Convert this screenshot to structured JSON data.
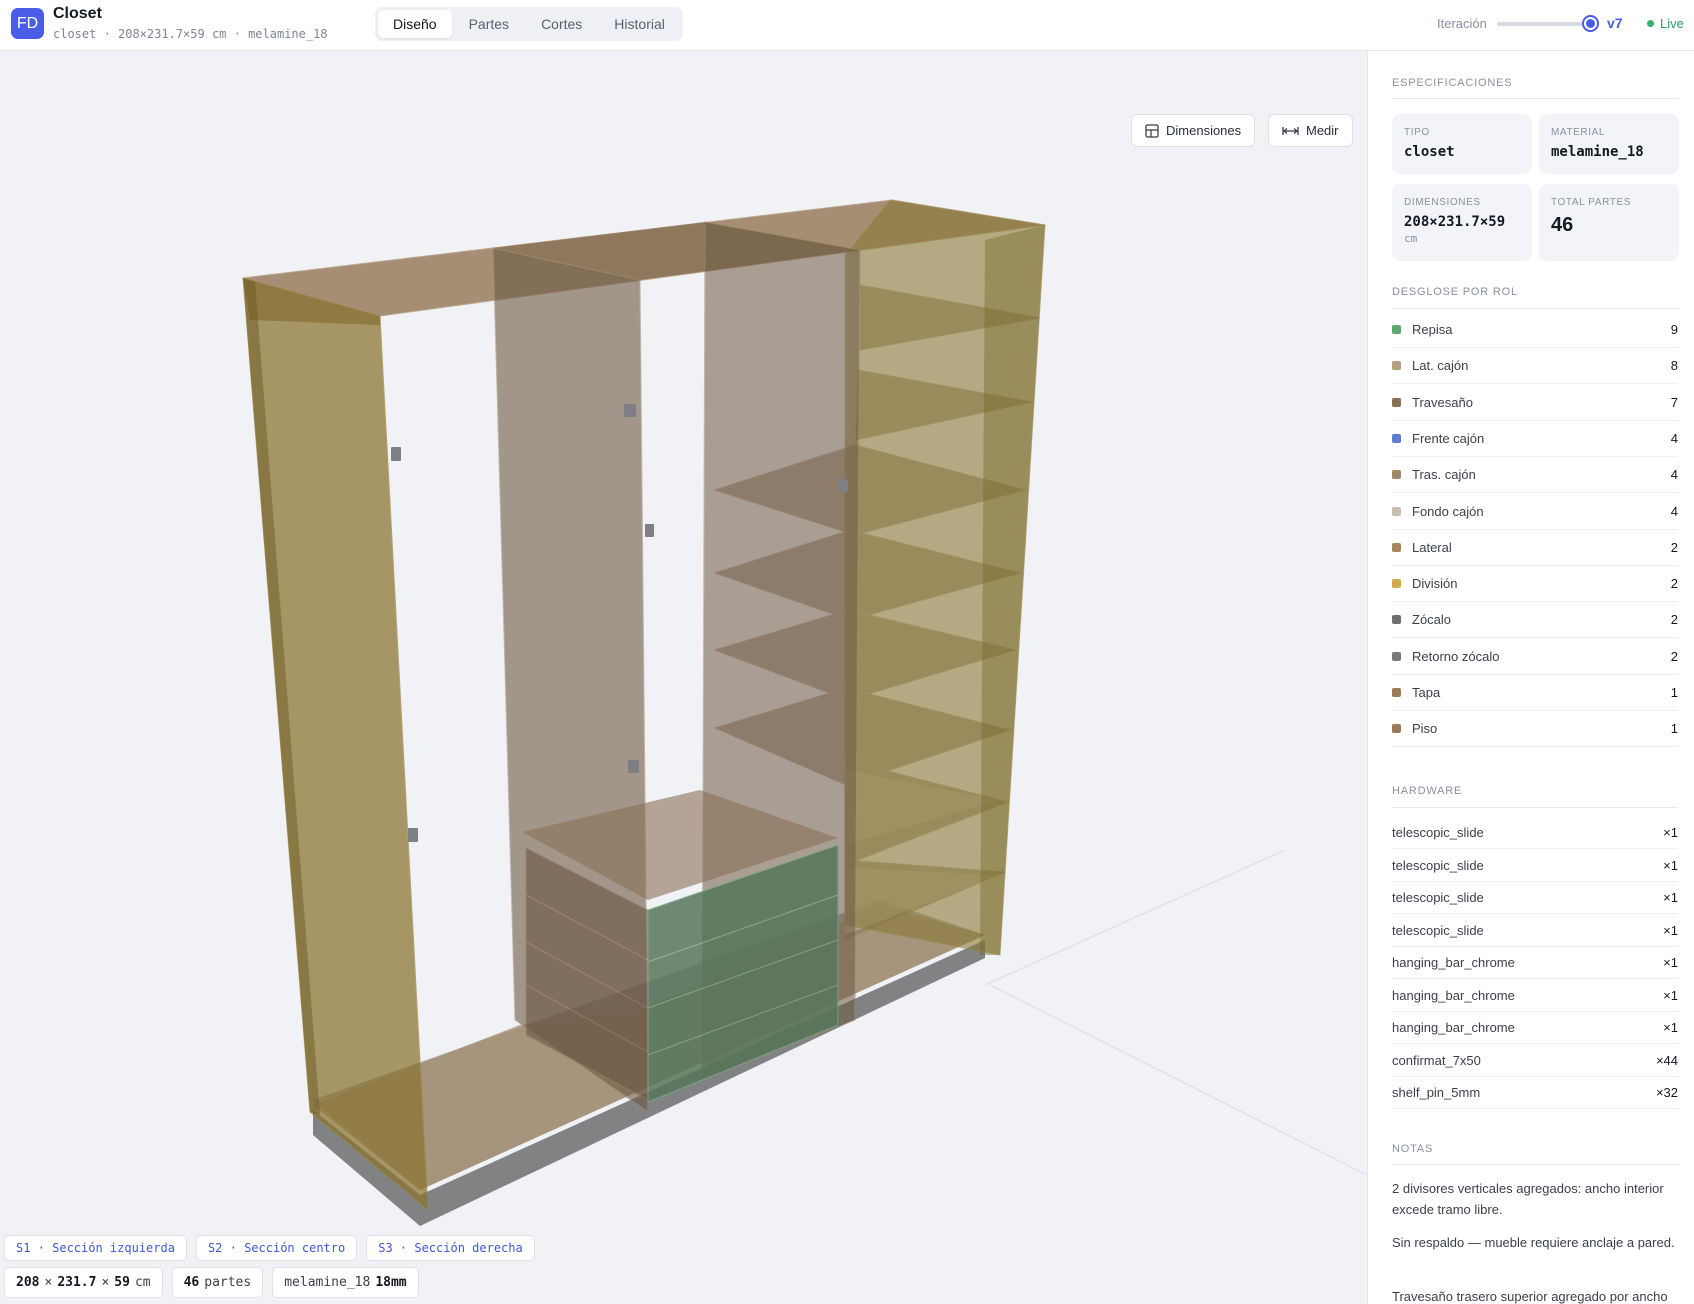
{
  "header": {
    "logo": "FD",
    "title": "Closet",
    "subtitle": "closet · 208×231.7×59 cm · melamine_18",
    "tabs": [
      "Diseño",
      "Partes",
      "Cortes",
      "Historial"
    ],
    "active_tab": "Diseño",
    "iteration_label": "Iteración",
    "iteration_version": "v7",
    "iteration_level": 1.0,
    "live_label": "Live"
  },
  "viewport": {
    "dimensions_button": "Dimensiones",
    "measure_button": "Medir",
    "sections": [
      "S1 · Sección izquierda",
      "S2 · Sección centro",
      "S3 · Sección derecha"
    ],
    "dims": {
      "w": "208",
      "h": "231.7",
      "d": "59",
      "sep": "×",
      "unit": "cm"
    },
    "parts": {
      "count": "46",
      "label": "partes"
    },
    "material": {
      "name": "melamine_18",
      "thickness": "18mm"
    }
  },
  "sidebar": {
    "specs_title": "Especificaciones",
    "specs": {
      "tipo_label": "Tipo",
      "tipo": "closet",
      "material_label": "Material",
      "material": "melamine_18",
      "dims_label": "Dimensiones",
      "dims": "208×231.7×59",
      "dims_unit": "cm",
      "total_label": "Total partes",
      "total": "46"
    },
    "roles_title": "Desglose por rol",
    "roles": [
      {
        "name": "Repisa",
        "count": "9",
        "color": "#5fa86b"
      },
      {
        "name": "Lat. cajón",
        "count": "8",
        "color": "#b3a07d"
      },
      {
        "name": "Travesaño",
        "count": "7",
        "color": "#8a6f53"
      },
      {
        "name": "Frente cajón",
        "count": "4",
        "color": "#5a7fd0"
      },
      {
        "name": "Tras. cajón",
        "count": "4",
        "color": "#a08866"
      },
      {
        "name": "Fondo cajón",
        "count": "4",
        "color": "#c9bfae"
      },
      {
        "name": "Lateral",
        "count": "2",
        "color": "#a6865a"
      },
      {
        "name": "División",
        "count": "2",
        "color": "#d4aa48"
      },
      {
        "name": "Zócalo",
        "count": "2",
        "color": "#6f6f6f"
      },
      {
        "name": "Retorno zócalo",
        "count": "2",
        "color": "#7a7a7a"
      },
      {
        "name": "Tapa",
        "count": "1",
        "color": "#9a7c56"
      },
      {
        "name": "Piso",
        "count": "1",
        "color": "#9a7c56"
      }
    ],
    "hardware_title": "Hardware",
    "hardware": [
      {
        "name": "telescopic_slide",
        "qty": "×1"
      },
      {
        "name": "telescopic_slide",
        "qty": "×1"
      },
      {
        "name": "telescopic_slide",
        "qty": "×1"
      },
      {
        "name": "telescopic_slide",
        "qty": "×1"
      },
      {
        "name": "hanging_bar_chrome",
        "qty": "×1"
      },
      {
        "name": "hanging_bar_chrome",
        "qty": "×1"
      },
      {
        "name": "hanging_bar_chrome",
        "qty": "×1"
      },
      {
        "name": "confirmat_7x50",
        "qty": "×44"
      },
      {
        "name": "shelf_pin_5mm",
        "qty": "×32"
      }
    ],
    "notes_title": "Notas",
    "notes": [
      "2 divisores verticales agregados: ancho interior excede tramo libre.",
      "Sin respaldo — mueble requiere anclaje a pared.",
      "Travesaño trasero superior agregado por ancho"
    ]
  }
}
